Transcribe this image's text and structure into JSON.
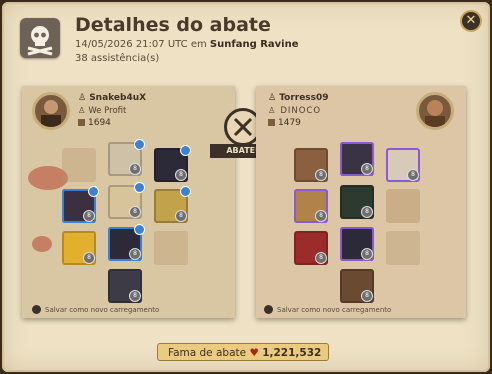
{
  "dialog": {
    "title": "Detalhes do abate",
    "datetime": "14/05/2026 21:07 UTC em",
    "location": "Sunfang Ravine",
    "assists": "38 assistência(s)",
    "close_icon": "close-icon"
  },
  "killer": {
    "name": "Snakeb4uX",
    "guild": "We Profit",
    "ip": "1694",
    "save_label": "Salvar como novo carregamento"
  },
  "victim": {
    "name": "Torress09",
    "guild": "DINOCO",
    "ip": "1479",
    "save_label": "Salvar como novo carregamento"
  },
  "center": {
    "label": "ABATEU",
    "icon": "crossed-swords-icon"
  },
  "fame": {
    "label": "Fama de abate",
    "value": "1,221,532"
  },
  "colors": {
    "parchment": "#eee1c4",
    "dark": "#3b3128",
    "gold": "#ebcb7f",
    "blood": "#a8281a"
  }
}
